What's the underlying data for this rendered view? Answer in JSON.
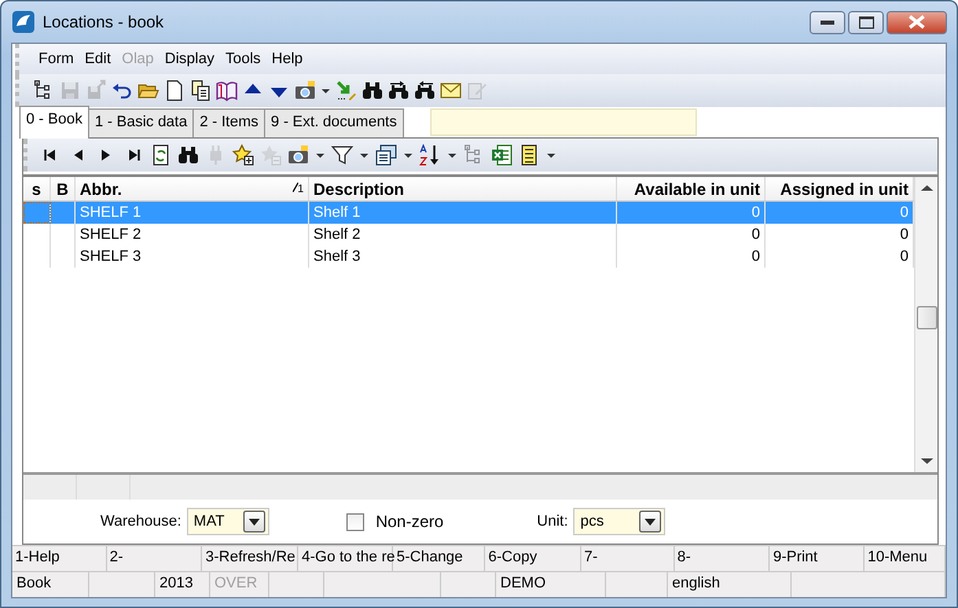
{
  "window": {
    "title": "Locations - book"
  },
  "menu": [
    {
      "label": "Form",
      "disabled": false
    },
    {
      "label": "Edit",
      "disabled": false
    },
    {
      "label": "Olap",
      "disabled": true
    },
    {
      "label": "Display",
      "disabled": false
    },
    {
      "label": "Tools",
      "disabled": false
    },
    {
      "label": "Help",
      "disabled": false
    }
  ],
  "toolbar": [
    {
      "kind": "tree",
      "disabled": false
    },
    {
      "kind": "save",
      "disabled": true
    },
    {
      "kind": "saveas",
      "disabled": true
    },
    {
      "kind": "undo",
      "disabled": false
    },
    {
      "kind": "open",
      "disabled": false
    },
    {
      "kind": "new",
      "disabled": false
    },
    {
      "kind": "copy",
      "disabled": false
    },
    {
      "kind": "book",
      "disabled": false
    },
    {
      "kind": "up",
      "disabled": false
    },
    {
      "kind": "down",
      "disabled": false
    },
    {
      "kind": "camera",
      "disabled": false
    },
    {
      "kind": "caret",
      "disabled": false
    },
    {
      "kind": "export",
      "disabled": false
    },
    {
      "kind": "find",
      "disabled": false
    },
    {
      "kind": "findnext",
      "disabled": false
    },
    {
      "kind": "findprev",
      "disabled": false
    },
    {
      "kind": "mail",
      "disabled": false
    },
    {
      "kind": "edit",
      "disabled": true
    }
  ],
  "tabs": [
    {
      "label": "0 - Book",
      "selected": true
    },
    {
      "label": "1 - Basic data",
      "selected": false
    },
    {
      "label": "2 - Items",
      "selected": false
    },
    {
      "label": "9 - Ext. documents",
      "selected": false
    }
  ],
  "grid_toolbar": [
    {
      "kind": "first",
      "disabled": false
    },
    {
      "kind": "prev",
      "disabled": false
    },
    {
      "kind": "next",
      "disabled": false
    },
    {
      "kind": "last",
      "disabled": false
    },
    {
      "kind": "refresh",
      "disabled": false
    },
    {
      "kind": "find",
      "disabled": false
    },
    {
      "kind": "plug",
      "disabled": true
    },
    {
      "kind": "add",
      "disabled": false
    },
    {
      "kind": "remove",
      "disabled": true
    },
    {
      "kind": "camera",
      "disabled": false
    },
    {
      "kind": "caret",
      "disabled": false
    },
    {
      "kind": "filter",
      "disabled": false
    },
    {
      "kind": "caret",
      "disabled": false
    },
    {
      "kind": "columns",
      "disabled": false
    },
    {
      "kind": "caret",
      "disabled": false
    },
    {
      "kind": "sort",
      "disabled": false
    },
    {
      "kind": "caret",
      "disabled": false
    },
    {
      "kind": "tree",
      "disabled": true
    },
    {
      "kind": "excel",
      "disabled": false
    },
    {
      "kind": "sheet",
      "disabled": false
    },
    {
      "kind": "caret",
      "disabled": false
    }
  ],
  "table": {
    "columns": [
      {
        "label": "s"
      },
      {
        "label": "B"
      },
      {
        "label": "Abbr.",
        "sort_mark": "1"
      },
      {
        "label": "Description"
      },
      {
        "label": "Available in unit"
      },
      {
        "label": "Assigned in unit"
      }
    ],
    "rows": [
      {
        "selected": true,
        "cells": [
          "",
          "",
          "SHELF 1",
          "Shelf 1",
          "0",
          "0"
        ]
      },
      {
        "selected": false,
        "cells": [
          "",
          "",
          "SHELF 2",
          "Shelf 2",
          "0",
          "0"
        ]
      },
      {
        "selected": false,
        "cells": [
          "",
          "",
          "SHELF 3",
          "Shelf 3",
          "0",
          "0"
        ]
      }
    ]
  },
  "filters": {
    "warehouse": {
      "label": "Warehouse:",
      "value": "MAT"
    },
    "non_zero": {
      "label": "Non-zero",
      "checked": false
    },
    "unit": {
      "label": "Unit:",
      "value": "pcs"
    }
  },
  "function_keys": [
    "1-Help",
    "2-",
    "3-Refresh/Re",
    "4-Go to the re",
    "5-Change",
    "6-Copy",
    "7-",
    "8-",
    "9-Print",
    "10-Menu"
  ],
  "status_bar": [
    {
      "text": "Book",
      "disabled": false
    },
    {
      "text": "2013",
      "disabled": false
    },
    {
      "text": "OVER",
      "disabled": true
    },
    {
      "text": "DEMO",
      "disabled": false
    },
    {
      "text": "english",
      "disabled": false
    }
  ]
}
